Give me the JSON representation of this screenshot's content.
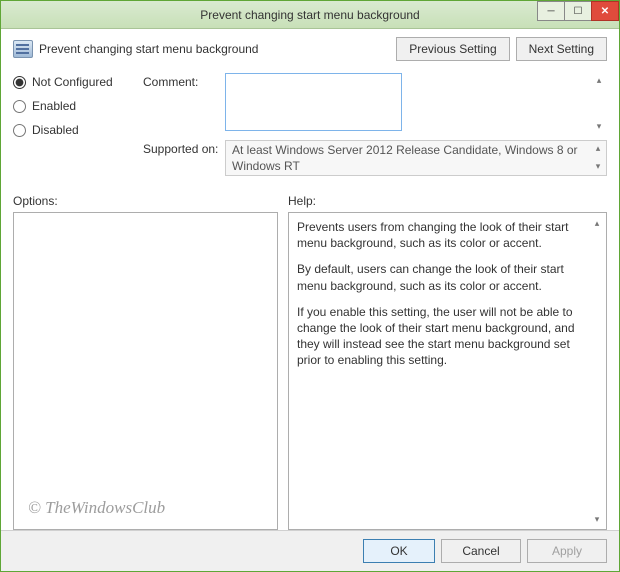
{
  "window": {
    "title": "Prevent changing start menu background"
  },
  "header": {
    "policy_title": "Prevent changing start menu background",
    "prev_btn": "Previous Setting",
    "next_btn": "Next Setting"
  },
  "radios": {
    "not_configured": "Not Configured",
    "enabled": "Enabled",
    "disabled": "Disabled",
    "selected": "not_configured"
  },
  "fields": {
    "comment_label": "Comment:",
    "comment_value": "",
    "supported_label": "Supported on:",
    "supported_value": "At least Windows Server 2012 Release Candidate, Windows 8 or Windows RT"
  },
  "panels": {
    "options_label": "Options:",
    "help_label": "Help:",
    "help_text": {
      "p1": "Prevents users from changing the look of their start menu background, such as its color or accent.",
      "p2": "By default, users can change the look of their start menu background, such as its color or accent.",
      "p3": "If you enable this setting, the user will not be able to change the look of their start menu background, and they will instead see the start menu background set prior to enabling this setting."
    }
  },
  "footer": {
    "ok": "OK",
    "cancel": "Cancel",
    "apply": "Apply"
  },
  "watermark": "© TheWindowsClub"
}
